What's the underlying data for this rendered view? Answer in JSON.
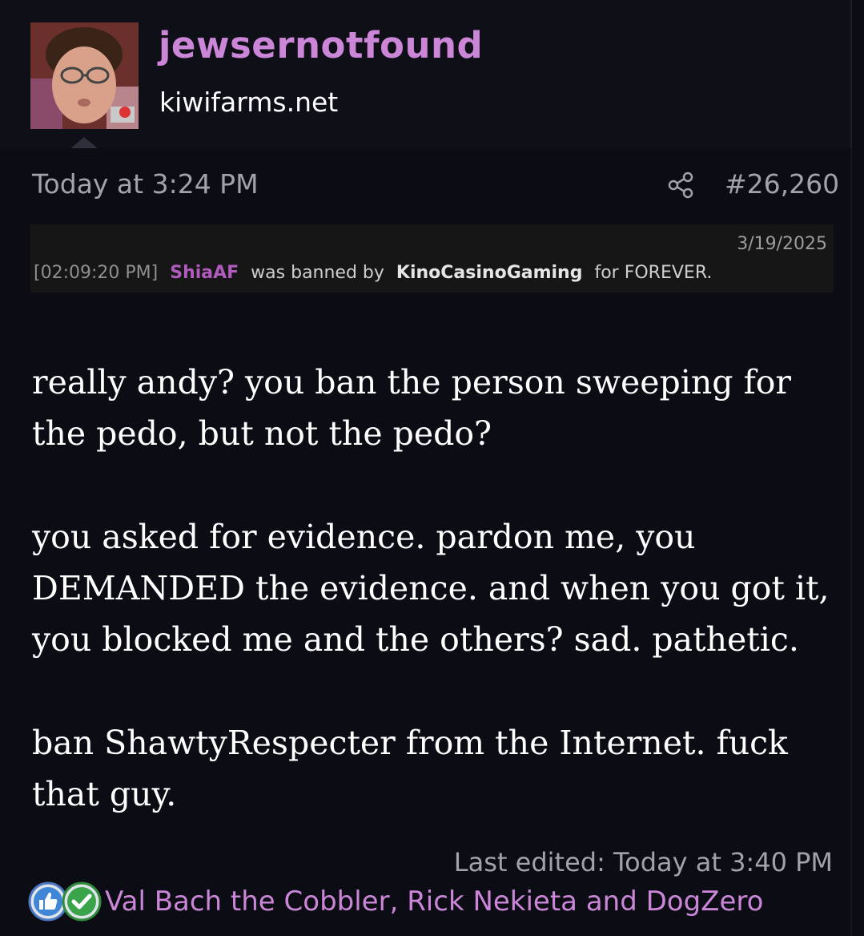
{
  "post": {
    "username": "jewsernotfound",
    "site": "kiwifarms.net",
    "timestamp": "Today at 3:24 PM",
    "post_number": "#26,260",
    "last_edited": "Last edited: Today at 3:40 PM"
  },
  "ban_log": {
    "date": "3/19/2025",
    "time": "[02:09:20 PM]",
    "banned_user": "ShiaAF",
    "middle_text": "was banned by",
    "moderator": "KinoCasinoGaming",
    "duration_text": "for FOREVER."
  },
  "message": {
    "paragraph_1": "really andy? you ban the person sweeping for the pedo, but not the pedo?",
    "paragraph_2": "you asked for evidence. pardon me, you DEMANDED the evidence. and when you got it, you blocked me and the others? sad. pathetic.",
    "paragraph_3": "ban ShawtyRespecter from the Internet. fuck that guy."
  },
  "reactions": {
    "icons": [
      "thumbs-up-icon",
      "checkmark-icon"
    ],
    "users": "Val Bach the Cobbler, Rick Nekieta and DogZero"
  },
  "colors": {
    "username": "#cb86d8",
    "banned_user": "#b05bbd",
    "background": "#0b0c14",
    "muted_text": "#a2a3aa"
  }
}
